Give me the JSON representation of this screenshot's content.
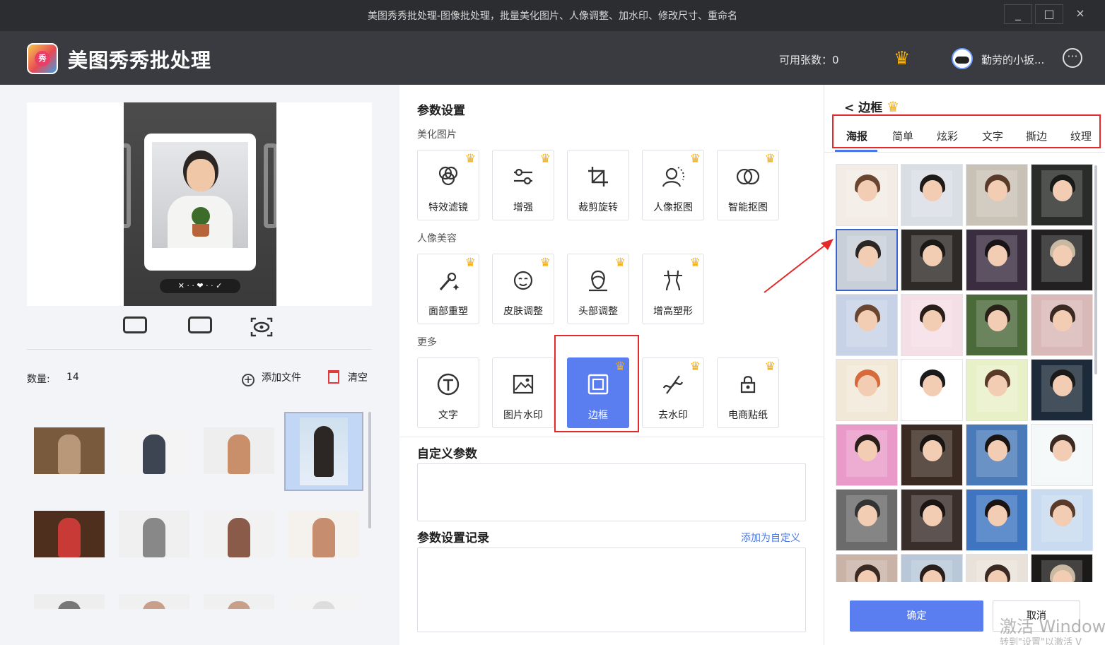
{
  "window": {
    "title": "美图秀秀批处理-图像批处理，批量美化图片、人像调整、加水印、修改尺寸、重命名",
    "controls": [
      "_",
      "□",
      "×"
    ]
  },
  "header": {
    "app_name": "美图秀秀批处理",
    "logo_text": "秀",
    "quota": "可用张数：0",
    "username": "勤劳的小扳...",
    "more_label": "···",
    "vip_icon": "crown-icon"
  },
  "left": {
    "preview_control": "✕ · · ❤ · · ✓",
    "count_label": "数量:",
    "count_value": "14",
    "add_files_label": "添加文件",
    "clear_label": "清空",
    "thumbnails": [
      {
        "c1": "#7a5a3c",
        "c2": "#b89878"
      },
      {
        "c1": "#f4f4f4",
        "c2": "#3d4452"
      },
      {
        "c1": "#eeeeee",
        "c2": "#c98e6a"
      },
      {
        "c1": "#cfe0ee",
        "c2": "#2c2725",
        "selected": true
      },
      {
        "c1": "#4e2f1e",
        "c2": "#c73a36"
      },
      {
        "c1": "#f0f0f0",
        "c2": "#888888"
      },
      {
        "c1": "#f2f2f2",
        "c2": "#8b5b4a"
      },
      {
        "c1": "#f5f2ee",
        "c2": "#c78d6f"
      },
      {
        "c1": "#eeeeee",
        "c2": "#777777"
      },
      {
        "c1": "#f0f0f0",
        "c2": "#c8a08a"
      },
      {
        "c1": "#f0f0f0",
        "c2": "#c8a08a"
      },
      {
        "c1": "#f4f4f4",
        "c2": "#dddddd"
      }
    ]
  },
  "params": {
    "title": "参数设置",
    "groups": [
      {
        "label": "美化图片",
        "tools": [
          {
            "label": "特效滤镜",
            "icon": "filter-icon",
            "vip": true
          },
          {
            "label": "增强",
            "icon": "enhance-icon",
            "vip": true
          },
          {
            "label": "裁剪旋转",
            "icon": "crop-icon",
            "vip": false
          },
          {
            "label": "人像抠图",
            "icon": "portrait-cutout-icon",
            "vip": true
          },
          {
            "label": "智能抠图",
            "icon": "smart-cutout-icon",
            "vip": true
          }
        ]
      },
      {
        "label": "人像美容",
        "tools": [
          {
            "label": "面部重塑",
            "icon": "face-reshape-icon",
            "vip": true
          },
          {
            "label": "皮肤调整",
            "icon": "skin-icon",
            "vip": true
          },
          {
            "label": "头部调整",
            "icon": "head-icon",
            "vip": true
          },
          {
            "label": "增高塑形",
            "icon": "body-shape-icon",
            "vip": true
          }
        ]
      },
      {
        "label": "更多",
        "tools": [
          {
            "label": "文字",
            "icon": "text-icon",
            "vip": false
          },
          {
            "label": "图片水印",
            "icon": "image-watermark-icon",
            "vip": false
          },
          {
            "label": "边框",
            "icon": "frame-icon",
            "vip": true,
            "active": true
          },
          {
            "label": "去水印",
            "icon": "remove-watermark-icon",
            "vip": true
          },
          {
            "label": "电商贴纸",
            "icon": "sticker-icon",
            "vip": true
          }
        ]
      }
    ],
    "custom_title": "自定义参数",
    "history_title": "参数设置记录",
    "add_custom_label": "添加为自定义"
  },
  "frame_panel": {
    "back_title": "< 边框",
    "tabs": [
      "海报",
      "简单",
      "炫彩",
      "文字",
      "撕边",
      "纹理"
    ],
    "active_tab": 0,
    "posters": [
      {
        "bg": "#f3ece6",
        "hair": "#6a4530"
      },
      {
        "bg": "#d9dde4",
        "hair": "#1e1a18"
      },
      {
        "bg": "#c8c1b6",
        "hair": "#5a3a28"
      },
      {
        "bg": "#2a2c2a",
        "hair": "#1a1a1a"
      },
      {
        "bg": "#c9cfd8",
        "hair": "#2b2623",
        "selected": true
      },
      {
        "bg": "#2e2a28",
        "hair": "#1c1816"
      },
      {
        "bg": "#3a2d3f",
        "hair": "#1a1418"
      },
      {
        "bg": "#222020",
        "hair": "#c9b8a2"
      },
      {
        "bg": "#c7d2e6",
        "hair": "#6a4530"
      },
      {
        "bg": "#f4dfe6",
        "hair": "#2a1e1a"
      },
      {
        "bg": "#4b6a3a",
        "hair": "#2a201a"
      },
      {
        "bg": "#d9b8b8",
        "hair": "#3a2a22"
      },
      {
        "bg": "#f2e8d8",
        "hair": "#d66a3a"
      },
      {
        "bg": "#ffffff",
        "hair": "#1a1a1a"
      },
      {
        "bg": "#e8f0c8",
        "hair": "#5a3a28"
      },
      {
        "bg": "#1d2a3a",
        "hair": "#1a1a1a"
      },
      {
        "bg": "#e99ac8",
        "hair": "#2a1e1a"
      },
      {
        "bg": "#3a2a22",
        "hair": "#1a1412"
      },
      {
        "bg": "#4a7ab8",
        "hair": "#1a1412"
      },
      {
        "bg": "#f4f8f8",
        "hair": "#3a2a22"
      },
      {
        "bg": "#6b6b6b",
        "hair": "#333333"
      },
      {
        "bg": "#3a2e2a",
        "hair": "#1a1412"
      },
      {
        "bg": "#3e74c0",
        "hair": "#1a1412"
      },
      {
        "bg": "#c8dbf0",
        "hair": "#5a3a28"
      },
      {
        "bg": "#c9b3a6",
        "hair": "#3a2a22"
      },
      {
        "bg": "#b8c8d8",
        "hair": "#2a1e1a"
      },
      {
        "bg": "#e9e2da",
        "hair": "#3a2a22"
      },
      {
        "bg": "#1c1a18",
        "hair": "#c9b8a2"
      }
    ],
    "confirm_label": "确定",
    "cancel_label": "取消"
  },
  "os_watermark": {
    "line1": "激活 Window",
    "line2": "转到\"设置\"以激活 V"
  },
  "colors": {
    "accent": "#5a7ef0",
    "crown": "#f4ae12",
    "highlight": "#e52828"
  }
}
